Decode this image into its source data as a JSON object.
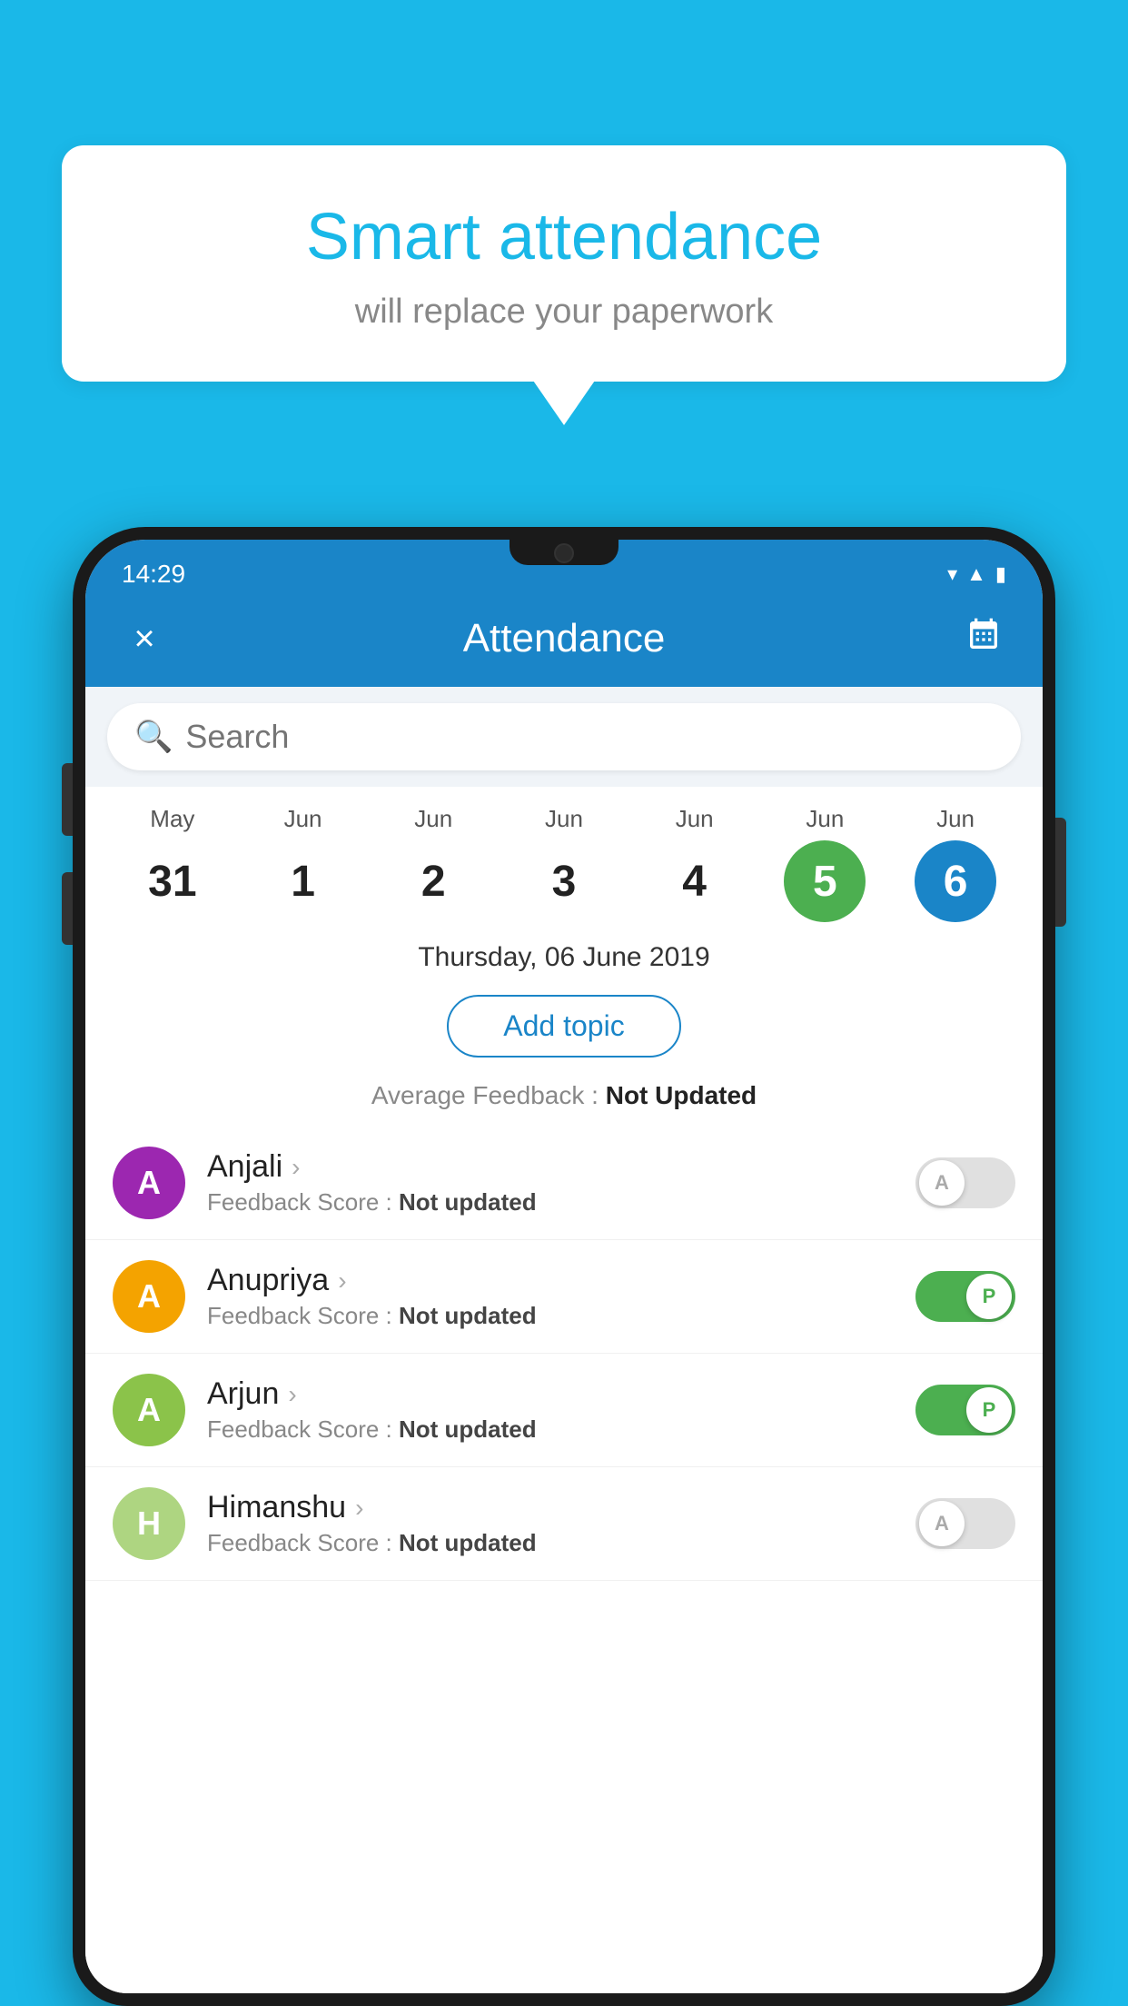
{
  "background_color": "#1ab8e8",
  "speech_bubble": {
    "title": "Smart attendance",
    "subtitle": "will replace your paperwork"
  },
  "status_bar": {
    "time": "14:29",
    "icons": [
      "wifi",
      "signal",
      "battery"
    ]
  },
  "app_bar": {
    "close_label": "×",
    "title": "Attendance",
    "calendar_icon": "📅"
  },
  "search": {
    "placeholder": "Search"
  },
  "calendar": {
    "days": [
      {
        "month": "May",
        "num": "31",
        "state": "normal"
      },
      {
        "month": "Jun",
        "num": "1",
        "state": "normal"
      },
      {
        "month": "Jun",
        "num": "2",
        "state": "normal"
      },
      {
        "month": "Jun",
        "num": "3",
        "state": "normal"
      },
      {
        "month": "Jun",
        "num": "4",
        "state": "normal"
      },
      {
        "month": "Jun",
        "num": "5",
        "state": "today"
      },
      {
        "month": "Jun",
        "num": "6",
        "state": "selected"
      }
    ]
  },
  "selected_date": "Thursday, 06 June 2019",
  "add_topic_label": "Add topic",
  "avg_feedback_label": "Average Feedback : ",
  "avg_feedback_value": "Not Updated",
  "students": [
    {
      "name": "Anjali",
      "initial": "A",
      "avatar_color": "#9c27b0",
      "feedback_label": "Feedback Score : ",
      "feedback_value": "Not updated",
      "toggle_state": "off"
    },
    {
      "name": "Anupriya",
      "initial": "A",
      "avatar_color": "#f4a300",
      "feedback_label": "Feedback Score : ",
      "feedback_value": "Not updated",
      "toggle_state": "on"
    },
    {
      "name": "Arjun",
      "initial": "A",
      "avatar_color": "#8bc34a",
      "feedback_label": "Feedback Score : ",
      "feedback_value": "Not updated",
      "toggle_state": "on"
    },
    {
      "name": "Himanshu",
      "initial": "H",
      "avatar_color": "#aed581",
      "feedback_label": "Feedback Score : ",
      "feedback_value": "Not updated",
      "toggle_state": "off"
    }
  ]
}
